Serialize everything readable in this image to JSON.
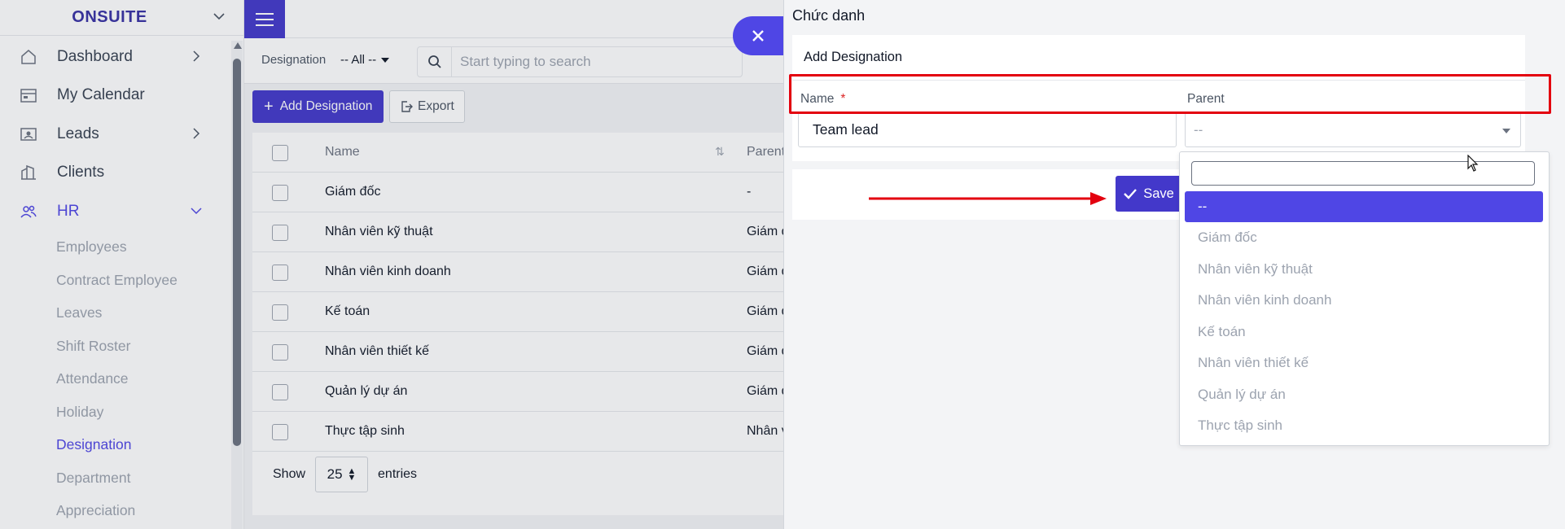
{
  "sidebar": {
    "brand": "ONSUITE",
    "items": [
      {
        "label": "Dashboard",
        "icon": "home-icon"
      },
      {
        "label": "My Calendar",
        "icon": "calendar-icon"
      },
      {
        "label": "Leads",
        "icon": "person-card-icon"
      },
      {
        "label": "Clients",
        "icon": "building-icon"
      },
      {
        "label": "HR",
        "icon": "users-icon"
      }
    ],
    "hr_subitems": [
      "Employees",
      "Contract Employee",
      "Leaves",
      "Shift Roster",
      "Attendance",
      "Holiday",
      "Designation",
      "Department",
      "Appreciation"
    ],
    "active_subitem": "Designation"
  },
  "filters": {
    "label": "Designation",
    "value": "-- All --",
    "search_placeholder": "Start typing to search"
  },
  "actions": {
    "add_label": "Add Designation",
    "export_label": "Export"
  },
  "table": {
    "headers": {
      "name": "Name",
      "parent": "Parent"
    },
    "rows": [
      {
        "name": "Giám đốc",
        "parent": "-"
      },
      {
        "name": "Nhân viên kỹ thuật",
        "parent": "Giám đ"
      },
      {
        "name": "Nhân viên kinh doanh",
        "parent": "Giám đ"
      },
      {
        "name": "Kế toán",
        "parent": "Giám đ"
      },
      {
        "name": "Nhân viên thiết kế",
        "parent": "Giám đ"
      },
      {
        "name": "Quản lý dự án",
        "parent": "Giám đ"
      },
      {
        "name": "Thực tập sinh",
        "parent": "Nhân v"
      }
    ],
    "show_label": "Show",
    "entries_value": "25",
    "entries_label": "entries"
  },
  "panel": {
    "title": "Chức danh",
    "card_title": "Add Designation",
    "name_label": "Name",
    "required_mark": "*",
    "name_value": "Team lead",
    "parent_label": "Parent",
    "parent_value": "--",
    "save_label": "Save",
    "dropdown_options": [
      "--",
      "Giám đốc",
      "Nhân viên kỹ thuật",
      "Nhân viên kinh doanh",
      "Kế toán",
      "Nhân viên thiết kế",
      "Quản lý dự án",
      "Thực tập sinh"
    ],
    "dropdown_selected": "--"
  },
  "colors": {
    "accent": "#4338ca",
    "highlight": "#e3000f"
  }
}
